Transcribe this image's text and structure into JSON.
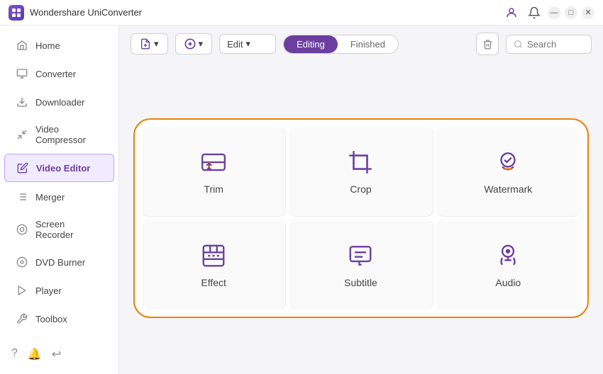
{
  "app": {
    "title": "Wondershare UniConverter"
  },
  "titlebar": {
    "controls": {
      "minimize": "—",
      "maximize": "□",
      "close": "✕"
    },
    "right_icons": [
      "👤",
      "🔔"
    ]
  },
  "sidebar": {
    "items": [
      {
        "id": "home",
        "label": "Home",
        "icon": "home"
      },
      {
        "id": "converter",
        "label": "Converter",
        "icon": "converter"
      },
      {
        "id": "downloader",
        "label": "Downloader",
        "icon": "download"
      },
      {
        "id": "video-compressor",
        "label": "Video Compressor",
        "icon": "compress"
      },
      {
        "id": "video-editor",
        "label": "Video Editor",
        "icon": "edit",
        "active": true
      },
      {
        "id": "merger",
        "label": "Merger",
        "icon": "merge"
      },
      {
        "id": "screen-recorder",
        "label": "Screen Recorder",
        "icon": "screen"
      },
      {
        "id": "dvd-burner",
        "label": "DVD Burner",
        "icon": "dvd"
      },
      {
        "id": "player",
        "label": "Player",
        "icon": "play"
      },
      {
        "id": "toolbox",
        "label": "Toolbox",
        "icon": "toolbox"
      }
    ],
    "footer_icons": [
      "help",
      "bell",
      "feedback"
    ]
  },
  "toolbar": {
    "add_file_label": "Add Files",
    "add_btn_label": "+",
    "edit_dropdown_label": "Edit",
    "tabs": {
      "editing": "Editing",
      "finished": "Finished"
    },
    "active_tab": "editing",
    "search_placeholder": "Search"
  },
  "editing_tiles": [
    {
      "id": "trim",
      "label": "Trim"
    },
    {
      "id": "crop",
      "label": "Crop"
    },
    {
      "id": "watermark",
      "label": "Watermark"
    },
    {
      "id": "effect",
      "label": "Effect"
    },
    {
      "id": "subtitle",
      "label": "Subtitle"
    },
    {
      "id": "audio",
      "label": "Audio"
    }
  ],
  "colors": {
    "accent": "#6b3fa0",
    "orange": "#e8820a",
    "active_bg": "#f0ebff",
    "active_border": "#c49eff"
  }
}
